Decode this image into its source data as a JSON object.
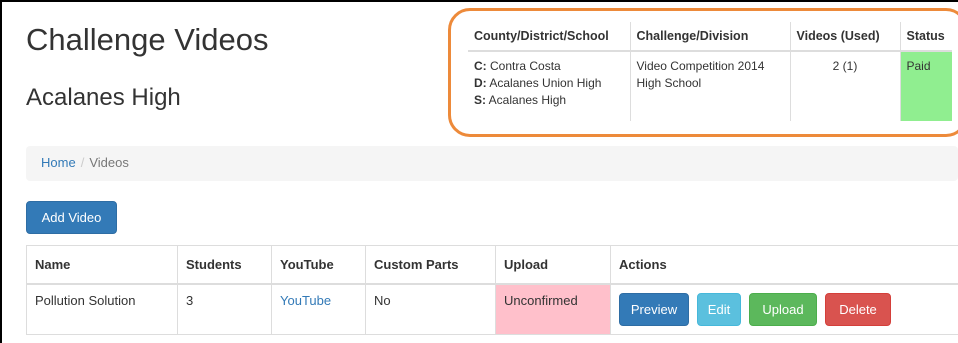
{
  "page": {
    "title": "Challenge Videos",
    "school": "Acalanes High"
  },
  "info_table": {
    "headers": [
      "County/District/School",
      "Challenge/Division",
      "Videos (Used)",
      "Status"
    ],
    "county_label": "C:",
    "county": "Contra Costa",
    "district_label": "D:",
    "district": "Acalanes Union High",
    "school_label": "S:",
    "school": "Acalanes High",
    "challenge": "Video Competition 2014",
    "division": "High School",
    "videos_used": "2 (1)",
    "status": "Paid",
    "status_color": "#90ee90"
  },
  "breadcrumb": {
    "home": "Home",
    "separator": "/",
    "current": "Videos"
  },
  "add_video_label": "Add Video",
  "videos_table": {
    "headers": [
      "Name",
      "Students",
      "YouTube",
      "Custom Parts",
      "Upload",
      "Actions"
    ],
    "rows": [
      {
        "name": "Pollution Solution",
        "students": "3",
        "youtube": "YouTube",
        "custom_parts": "No",
        "upload": "Unconfirmed",
        "actions": {
          "preview": "Preview",
          "edit": "Edit",
          "upload": "Upload",
          "delete": "Delete"
        }
      }
    ]
  },
  "colors": {
    "highlight_border": "#ed8a3a",
    "unconfirmed_bg": "#ffc0cb",
    "primary": "#337ab7",
    "info": "#5bc0de",
    "success": "#5cb85c",
    "danger": "#d9534f"
  }
}
